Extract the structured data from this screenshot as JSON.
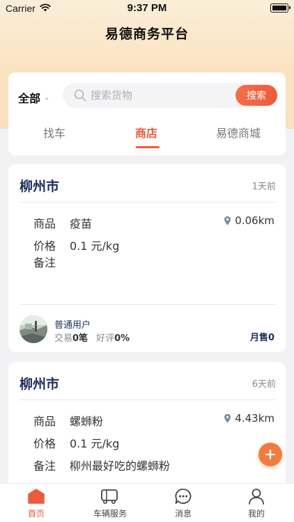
{
  "status_bar": {
    "carrier": "Carrier",
    "time": "9:37 PM"
  },
  "app": {
    "title": "易德商务平台"
  },
  "search": {
    "scope": "全部",
    "placeholder": "搜索货物",
    "button_label": "搜索"
  },
  "tabs": [
    {
      "label": "找车",
      "active": false
    },
    {
      "label": "商店",
      "active": true
    },
    {
      "label": "易德商城",
      "active": false
    }
  ],
  "labels": {
    "product": "商品",
    "price": "价格",
    "remark": "备注"
  },
  "listings": [
    {
      "city": "柳州市",
      "time_ago": "1天前",
      "product": "疫苗",
      "distance": "0.06km",
      "price": "0.1 元/kg",
      "remark": "",
      "user": {
        "name": "普通用户",
        "trade_label": "交易",
        "trade_count": "0笔",
        "rating_label": "好评",
        "rating": "0%",
        "monthly_sales": "月售0"
      }
    },
    {
      "city": "柳州市",
      "time_ago": "6天前",
      "product": "螺蛳粉",
      "distance": "4.43km",
      "price": "0.1 元/kg",
      "remark": "柳州最好吃的螺蛳粉"
    }
  ],
  "bottom_nav": [
    {
      "label": "首页",
      "icon": "home-icon",
      "active": true
    },
    {
      "label": "车辆服务",
      "icon": "truck-icon",
      "active": false
    },
    {
      "label": "消息",
      "icon": "chat-icon",
      "active": false
    },
    {
      "label": "我的",
      "icon": "user-icon",
      "active": false
    }
  ],
  "colors": {
    "accent": "#ee5a3b",
    "city_text": "#1d2e5c",
    "fab": "#f27c3f"
  }
}
